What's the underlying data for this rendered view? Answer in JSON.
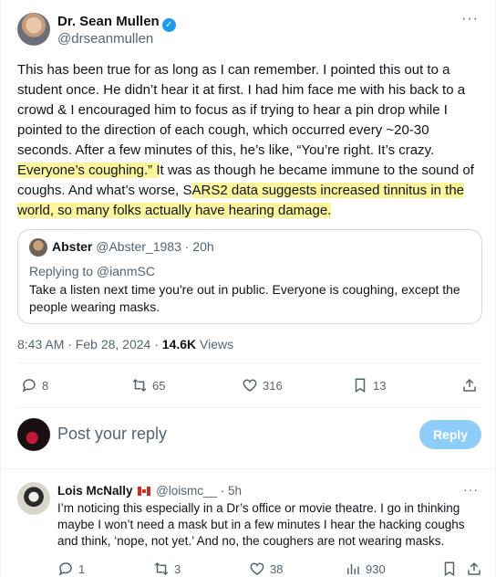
{
  "tweet": {
    "author_name": "Dr. Sean Mullen",
    "author_handle": "@drseanmullen",
    "more": "···",
    "text_before": "This has been true for as long as I can remember. I pointed this out to a student once. He didn’t hear it at first. I had him face me with his back to a crowd & I encouraged him to focus as if trying to hear a pin drop while I pointed to the direction of each cough, which occurred every ~20-30 seconds. After a few minutes of this, he’s like, “You’re right. It’s crazy. ",
    "text_hl1": "Everyone’s coughing.” I",
    "text_mid": "t was as though he became immune to the sound of coughs. And what’s worse, S",
    "text_hl2": "ARS2 data suggests increased tinnitus in the world, so many folks actually have hearing damage.",
    "timestamp": "8:43 AM · Feb 28, 2024",
    "separator": " · ",
    "views_count": "14.6K",
    "views_label": " Views",
    "replies": "8",
    "reposts": "65",
    "likes": "316",
    "bookmarks": "13"
  },
  "quoted": {
    "author_name": "Abster",
    "author_handle": "@Abster_1983",
    "time": " · 20h",
    "replying_to": "Replying to @ianmSC",
    "text": "Take a listen next time you're out in public. Everyone is coughing, except the people wearing masks."
  },
  "compose": {
    "placeholder": "Post your reply",
    "button_label": "Reply"
  },
  "comment": {
    "author_name": "Lois McNally",
    "author_handle": "@loismc__",
    "time": " · 5h",
    "more": "···",
    "text": "I’m noticing this especially in a Dr’s office or movie theatre. I go in thinking maybe I won’t need a mask but in a few minutes I hear the hacking coughs and think, ‘nope, not yet.’ And no, the coughers are not wearing masks.",
    "replies": "1",
    "reposts": "3",
    "likes": "38",
    "views": "930"
  },
  "colors": {
    "accent": "#1d9bf0",
    "reply_button": "#8ecdf8",
    "highlight": "#fcf59b",
    "muted_text": "#536471"
  },
  "icons": [
    "verified-badge-icon",
    "reply-icon",
    "repost-icon",
    "like-icon",
    "bookmark-icon",
    "share-icon",
    "views-icon",
    "canada-flag-icon"
  ]
}
